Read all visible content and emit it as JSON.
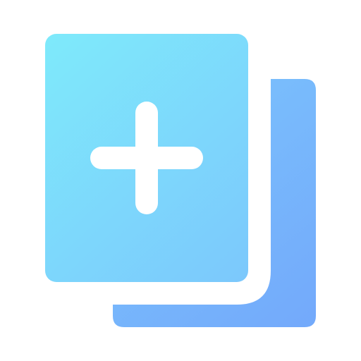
{
  "icon": {
    "name": "add-document-copy-icon",
    "colors": {
      "gradient_start": "#7EEAFB",
      "gradient_mid": "#7CC6FC",
      "gradient_end": "#73A9FB",
      "plus": "#FFFFFF"
    }
  }
}
